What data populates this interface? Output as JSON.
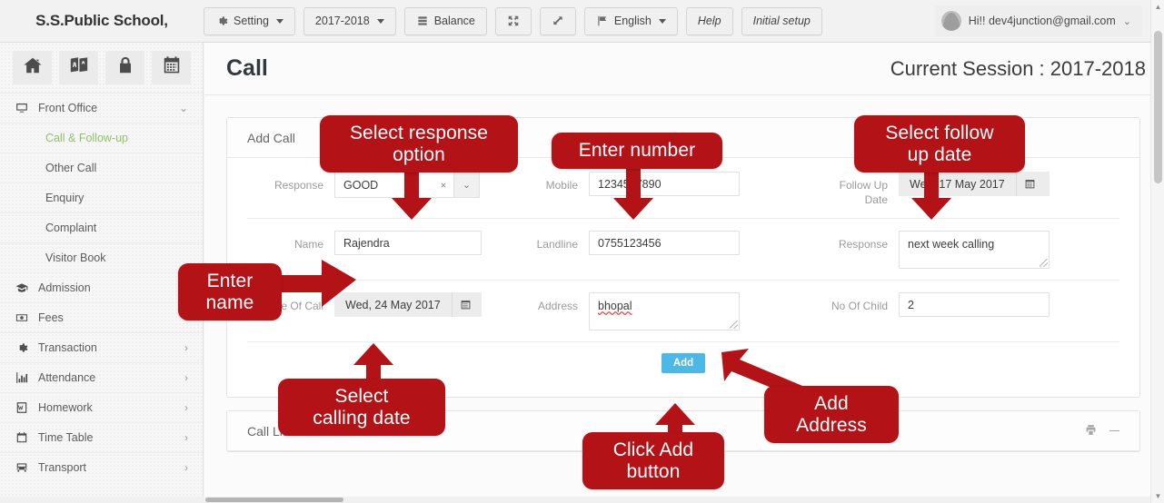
{
  "topbar": {
    "brand": "S.S.Public School,",
    "buttons": [
      {
        "label": "Setting",
        "icon": "gear-icon",
        "caret": true
      },
      {
        "label": "2017-2018",
        "icon": null,
        "caret": true
      },
      {
        "label": "Balance",
        "icon": "database-icon",
        "caret": false
      },
      {
        "label": "",
        "icon": "expand-arrows-icon",
        "caret": false
      },
      {
        "label": "",
        "icon": "resize-diagonal-icon",
        "caret": false
      },
      {
        "label": "English",
        "icon": "flag-icon",
        "caret": true
      },
      {
        "label": "Help",
        "icon": null,
        "caret": false
      },
      {
        "label": "Initial setup",
        "icon": null,
        "caret": false
      }
    ],
    "user": {
      "greeting": "Hi!! dev4junction@gmail.com",
      "caret": "⌄"
    }
  },
  "sidebar": {
    "quick_icons": [
      "home-icon",
      "translate-icon",
      "lock-icon",
      "calendar-icon"
    ],
    "items": [
      {
        "label": "Front Office",
        "icon": "monitor-icon",
        "arrow": "⌄",
        "sub": false,
        "active": false
      },
      {
        "label": "Call & Follow-up",
        "icon": null,
        "arrow": "",
        "sub": true,
        "active": true
      },
      {
        "label": "Other Call",
        "icon": null,
        "arrow": "",
        "sub": true,
        "active": false
      },
      {
        "label": "Enquiry",
        "icon": null,
        "arrow": "",
        "sub": true,
        "active": false
      },
      {
        "label": "Complaint",
        "icon": null,
        "arrow": "",
        "sub": true,
        "active": false
      },
      {
        "label": "Visitor Book",
        "icon": null,
        "arrow": "",
        "sub": true,
        "active": false
      },
      {
        "label": "Admission",
        "icon": "graduation-cap-icon",
        "arrow": "›",
        "sub": false,
        "active": false
      },
      {
        "label": "Fees",
        "icon": "money-icon",
        "arrow": "›",
        "sub": false,
        "active": false
      },
      {
        "label": "Transaction",
        "icon": "gear-icon",
        "arrow": "›",
        "sub": false,
        "active": false
      },
      {
        "label": "Attendance",
        "icon": "bar-chart-icon",
        "arrow": "›",
        "sub": false,
        "active": false
      },
      {
        "label": "Homework",
        "icon": "doc-w-icon",
        "arrow": "›",
        "sub": false,
        "active": false
      },
      {
        "label": "Time Table",
        "icon": "calendar-icon",
        "arrow": "›",
        "sub": false,
        "active": false
      },
      {
        "label": "Transport",
        "icon": "bus-icon",
        "arrow": "›",
        "sub": false,
        "active": false
      }
    ]
  },
  "page": {
    "title": "Call",
    "session": "Current Session : 2017-2018"
  },
  "add_call": {
    "panel_title": "Add Call",
    "fields": {
      "response_select_label": "Response",
      "response_select_value": "GOOD",
      "response_clear": "×",
      "response_caret": "⌄",
      "mobile_label": "Mobile",
      "mobile_value": "1234567890",
      "followup_label": "Follow Up Date",
      "followup_value": "Wed, 17 May 2017",
      "name_label": "Name",
      "name_value": "Rajendra",
      "landline_label": "Landline",
      "landline_value": "0755123456",
      "response_text_label": "Response",
      "response_text_value": "next week calling",
      "date_of_call_label": "Date Of Call",
      "date_of_call_value": "Wed, 24 May 2017",
      "address_label": "Address",
      "address_value": "bhopal",
      "no_of_child_label": "No Of Child",
      "no_of_child_value": "2"
    },
    "add_button": "Add"
  },
  "call_list": {
    "panel_title": "Call List",
    "print_icon": "print-icon",
    "minimize_icon": "minimize-icon"
  },
  "annotations": [
    {
      "id": "a1",
      "text": "Select response\noption"
    },
    {
      "id": "a2",
      "text": "Enter number"
    },
    {
      "id": "a3",
      "text": "Select follow\nup date"
    },
    {
      "id": "a4",
      "text": "Enter\nname"
    },
    {
      "id": "a5",
      "text": "Select\ncalling date"
    },
    {
      "id": "a6",
      "text": "Click Add\nbutton"
    },
    {
      "id": "a7",
      "text": "Add\nAddress"
    }
  ],
  "colors": {
    "annotation_red": "#b31217",
    "add_button_blue": "#4db8e5",
    "active_menu_green": "#8fc26b"
  }
}
